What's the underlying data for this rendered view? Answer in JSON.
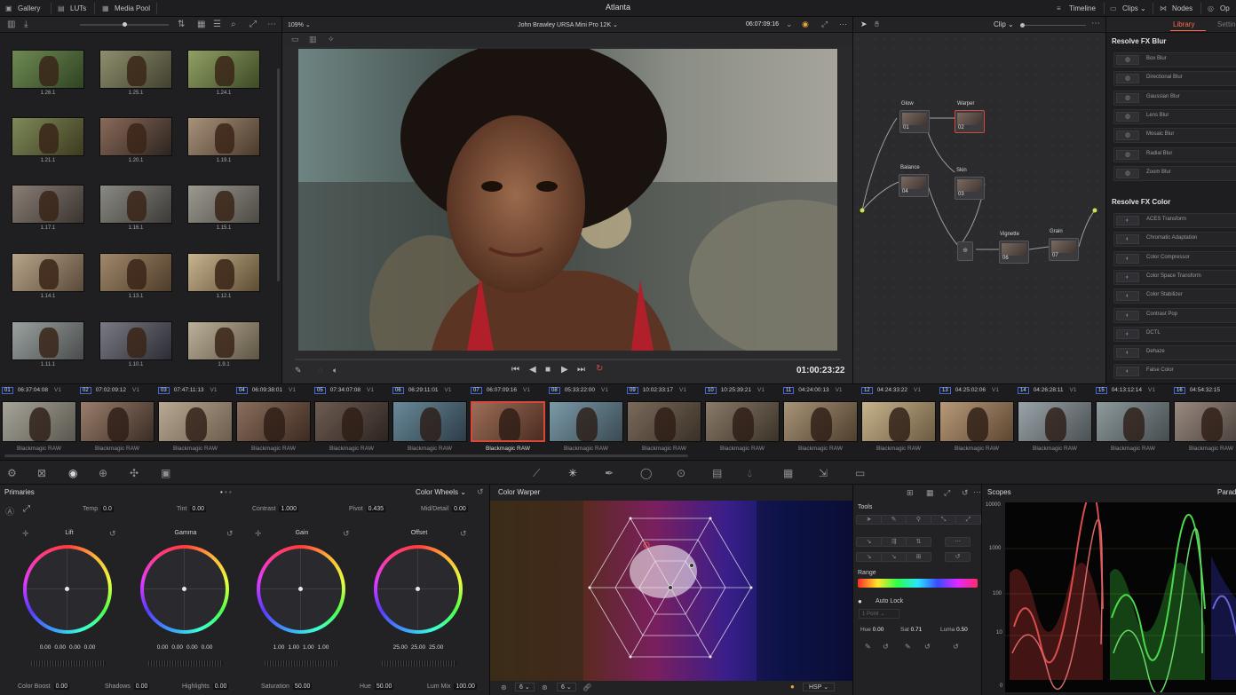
{
  "app": {
    "title": "Atlanta"
  },
  "topbar": {
    "left_tabs": [
      {
        "label": "Gallery",
        "icon": "gallery-icon"
      },
      {
        "label": "LUTs",
        "icon": "luts-icon"
      },
      {
        "label": "Media Pool",
        "icon": "media-pool-icon"
      }
    ],
    "right_tabs": [
      {
        "label": "Timeline",
        "icon": "timeline-icon"
      },
      {
        "label": "Clips",
        "icon": "clips-icon"
      },
      {
        "label": "Nodes",
        "icon": "nodes-icon"
      },
      {
        "label": "Op",
        "icon": "openfx-icon"
      }
    ]
  },
  "gallery": {
    "stills": [
      {
        "label": "1.26.1"
      },
      {
        "label": "1.25.1"
      },
      {
        "label": "1.24.1"
      },
      {
        "label": "1.21.1"
      },
      {
        "label": "1.20.1"
      },
      {
        "label": "1.19.1"
      },
      {
        "label": "1.17.1"
      },
      {
        "label": "1.16.1"
      },
      {
        "label": "1.15.1"
      },
      {
        "label": "1.14.1"
      },
      {
        "label": "1.13.1"
      },
      {
        "label": "1.12.1"
      },
      {
        "label": "1.11.1"
      },
      {
        "label": "1.10.1"
      },
      {
        "label": "1.9.1"
      }
    ]
  },
  "viewer": {
    "zoom": "109%",
    "camera": "John Brawley URSA Mini Pro 12K",
    "source_tc": "06:07:09:16",
    "record_tc": "01:00:23:22"
  },
  "node_editor": {
    "mode": "Clip",
    "nodes": [
      {
        "label": "Glow",
        "num": "01"
      },
      {
        "label": "Warper",
        "num": "02"
      },
      {
        "label": "Balance",
        "num": "04"
      },
      {
        "label": "Skin",
        "num": "03"
      },
      {
        "label": "Vignette",
        "num": "06"
      },
      {
        "label": "Grain",
        "num": "07"
      }
    ]
  },
  "library": {
    "tab_active": "Library",
    "tab_other": "Setting",
    "blur_heading": "Resolve FX Blur",
    "blur_items": [
      "Box Blur",
      "Directional Blur",
      "Gaussian Blur",
      "Lens Blur",
      "Mosaic Blur",
      "Radial Blur",
      "Zoom Blur"
    ],
    "color_heading": "Resolve FX Color",
    "color_items": [
      "ACES Transform",
      "Chromatic Adaptation",
      "Color Compressor",
      "Color Space Transform",
      "Color Stabilizer",
      "Contrast Pop",
      "DCTL",
      "Dehaze",
      "False Color"
    ]
  },
  "timeline": {
    "clips": [
      {
        "num": "01",
        "tc": "06:37:04:08",
        "track": "V1",
        "codec": "Blackmagic RAW"
      },
      {
        "num": "02",
        "tc": "07:02:09:12",
        "track": "V1",
        "codec": "Blackmagic RAW"
      },
      {
        "num": "03",
        "tc": "07:47:11:13",
        "track": "V1",
        "codec": "Blackmagic RAW"
      },
      {
        "num": "04",
        "tc": "06:09:38:01",
        "track": "V1",
        "codec": "Blackmagic RAW"
      },
      {
        "num": "05",
        "tc": "07:34:07:08",
        "track": "V1",
        "codec": "Blackmagic RAW"
      },
      {
        "num": "06",
        "tc": "06:29:11:01",
        "track": "V1",
        "codec": "Blackmagic RAW"
      },
      {
        "num": "07",
        "tc": "06:07:09:16",
        "track": "V1",
        "codec": "Blackmagic RAW",
        "selected": true
      },
      {
        "num": "08",
        "tc": "05:33:22:00",
        "track": "V1",
        "codec": "Blackmagic RAW"
      },
      {
        "num": "09",
        "tc": "10:02:33:17",
        "track": "V1",
        "codec": "Blackmagic RAW"
      },
      {
        "num": "10",
        "tc": "10:25:39:21",
        "track": "V1",
        "codec": "Blackmagic RAW"
      },
      {
        "num": "11",
        "tc": "04:24:00:13",
        "track": "V1",
        "codec": "Blackmagic RAW"
      },
      {
        "num": "12",
        "tc": "04:24:33:22",
        "track": "V1",
        "codec": "Blackmagic RAW"
      },
      {
        "num": "13",
        "tc": "04:25:02:06",
        "track": "V1",
        "codec": "Blackmagic RAW"
      },
      {
        "num": "14",
        "tc": "04:26:28:11",
        "track": "V1",
        "codec": "Blackmagic RAW"
      },
      {
        "num": "15",
        "tc": "04:13:12:14",
        "track": "V1",
        "codec": "Blackmagic RAW"
      },
      {
        "num": "16",
        "tc": "04:54:32:15",
        "track": "",
        "codec": "Blackmagic RAW"
      }
    ]
  },
  "primaries": {
    "title": "Primaries",
    "mode": "Color Wheels",
    "temp_label": "Temp",
    "temp": "0.0",
    "tint_label": "Tint",
    "tint": "0.00",
    "contrast_label": "Contrast",
    "contrast": "1.000",
    "pivot_label": "Pivot",
    "pivot": "0.435",
    "middetail_label": "Mid/Detail",
    "middetail": "0.00",
    "wheels": [
      {
        "name": "Lift",
        "values": [
          "0.00",
          "0.00",
          "0.00",
          "0.00"
        ]
      },
      {
        "name": "Gamma",
        "values": [
          "0.00",
          "0.00",
          "0.00",
          "0.00"
        ]
      },
      {
        "name": "Gain",
        "values": [
          "1.00",
          "1.00",
          "1.00",
          "1.00"
        ]
      },
      {
        "name": "Offset",
        "values": [
          "25.00",
          "25.00",
          "25.00"
        ]
      }
    ],
    "colorboost_label": "Color Boost",
    "colorboost": "0.00",
    "shadows_label": "Shadows",
    "shadows": "0.00",
    "highlights_label": "Highlights",
    "highlights": "0.00",
    "saturation_label": "Saturation",
    "saturation": "50.00",
    "hue_label": "Hue",
    "hue": "50.00",
    "lummix_label": "Lum Mix",
    "lummix": "100.00"
  },
  "warper": {
    "title": "Color Warper",
    "bottom_left": "6",
    "bottom_mid": "6",
    "mode": "HSP"
  },
  "tools": {
    "title": "Tools",
    "range_label": "Range",
    "autolock_label": "Auto Lock",
    "points_label": "1 Point",
    "hue_label": "Hue",
    "hue": "0.00",
    "sat_label": "Sat",
    "sat": "0.71",
    "luma_label": "Luma",
    "luma": "0.50"
  },
  "scopes": {
    "title": "Scopes",
    "mode": "Parad",
    "scale": [
      "10000",
      "1000",
      "100",
      "10",
      "0"
    ]
  },
  "colors": {
    "accent": "#d8483a",
    "clip_num": "#4468d8",
    "node_link": "#c8e64a"
  }
}
